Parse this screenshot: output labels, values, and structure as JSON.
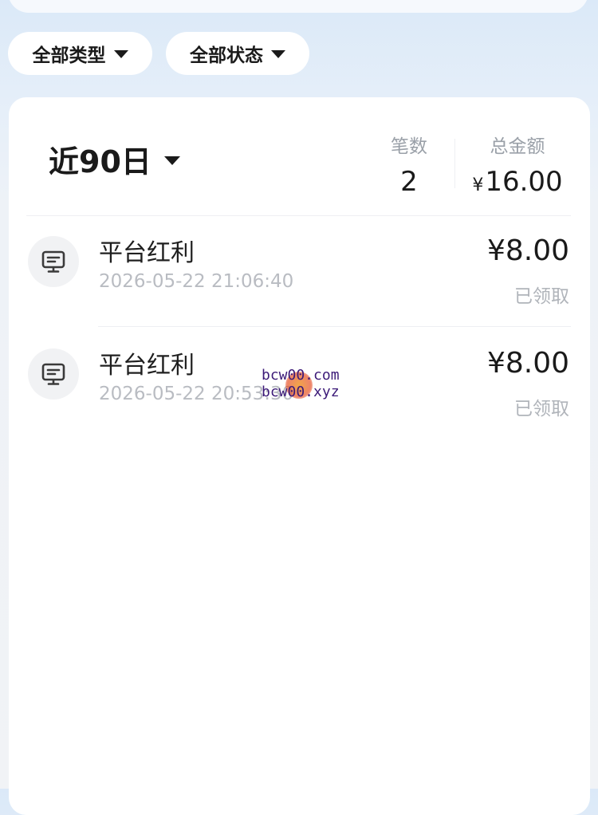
{
  "filters": {
    "type_label": "全部类型",
    "status_label": "全部状态"
  },
  "summary": {
    "period_label": "近90日",
    "count_label": "笔数",
    "count_value": "2",
    "total_label": "总金额",
    "total_currency": "¥",
    "total_value": "16.00"
  },
  "records": [
    {
      "title": "平台红利",
      "time": "2026-05-22 21:06:40",
      "amount": "¥8.00",
      "status": "已领取"
    },
    {
      "title": "平台红利",
      "time": "2026-05-22 20:53:30",
      "amount": "¥8.00",
      "status": "已领取"
    }
  ],
  "watermark": {
    "line1": "bcw00.com",
    "line2": "bcw00.xyz"
  },
  "icons": {
    "record_icon": "monitor-icon",
    "caret_icon": "caret-down-icon"
  },
  "colors": {
    "background_top": "#dbe9f8",
    "card": "#ffffff",
    "text_primary": "#1a1a1a",
    "text_muted": "#b9bcc2",
    "watermark": "#3c1a78"
  }
}
